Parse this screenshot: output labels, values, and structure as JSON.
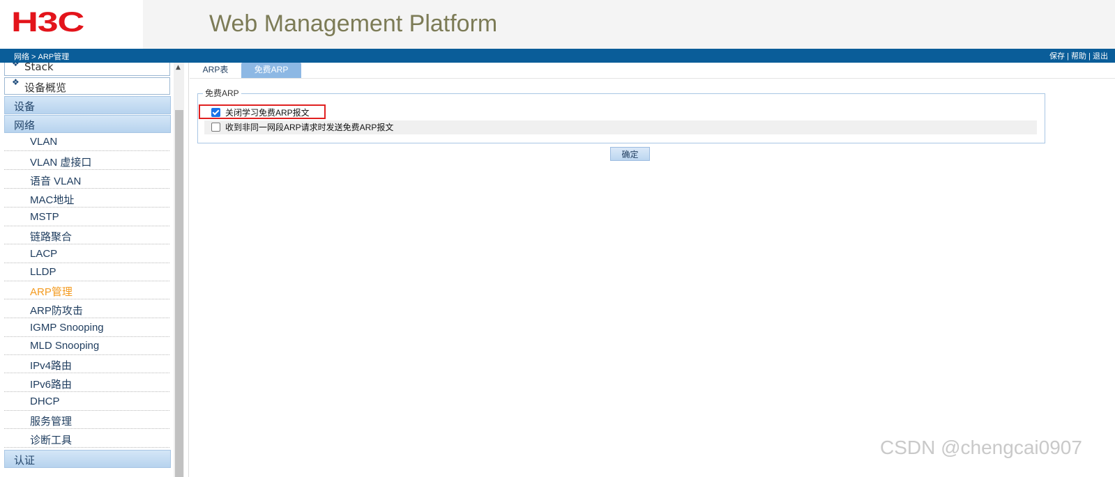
{
  "header": {
    "logo": "H3C",
    "title": "Web Management Platform"
  },
  "topbar": {
    "breadcrumb": "网络 > ARP管理",
    "links": {
      "save": "保存",
      "help": "帮助",
      "logout": "退出",
      "sep": " | "
    }
  },
  "sidebar": {
    "boxes": [
      "Stack",
      "设备概览"
    ],
    "sections": [
      "设备",
      "网络",
      "认证"
    ],
    "items": [
      "VLAN",
      "VLAN 虚接口",
      "语音 VLAN",
      "MAC地址",
      "MSTP",
      "链路聚合",
      "LACP",
      "LLDP",
      "ARP管理",
      "ARP防攻击",
      "IGMP Snooping",
      "MLD Snooping",
      "IPv4路由",
      "IPv6路由",
      "DHCP",
      "服务管理",
      "诊断工具"
    ],
    "active_item": "ARP管理"
  },
  "tabs": [
    "ARP表",
    "免费ARP"
  ],
  "active_tab": "免费ARP",
  "fieldset": {
    "legend": "免费ARP",
    "options": [
      {
        "label": "关闭学习免费ARP报文",
        "checked": true
      },
      {
        "label": "收到非同一网段ARP请求时发送免费ARP报文",
        "checked": false
      }
    ]
  },
  "confirm_label": "确定",
  "watermark": "CSDN @chengcai0907",
  "colors": {
    "brand_red": "#e3141b",
    "topbar_blue": "#0a5d99",
    "active_orange": "#f39a1f",
    "tab_active": "#8db8e4"
  }
}
